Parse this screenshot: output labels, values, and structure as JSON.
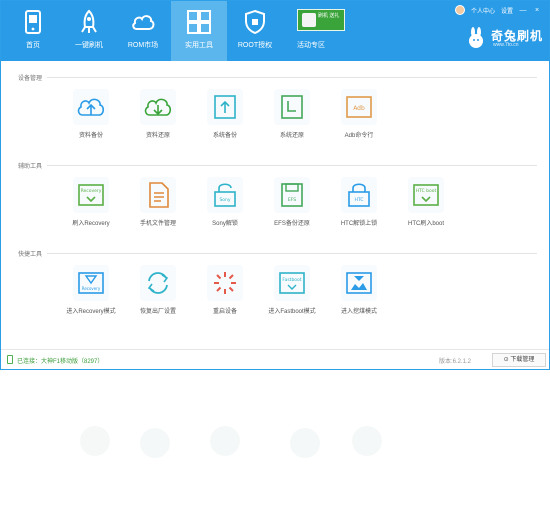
{
  "nav": [
    {
      "label": "首页",
      "icon": "home-icon"
    },
    {
      "label": "一键刷机",
      "icon": "rocket-icon"
    },
    {
      "label": "ROM市场",
      "icon": "cloud-icon"
    },
    {
      "label": "实用工具",
      "icon": "grid-icon"
    },
    {
      "label": "ROOT授权",
      "icon": "shield-icon"
    },
    {
      "label": "活动专区",
      "icon": "gift-icon"
    }
  ],
  "banner_text": "刷机\n送礼",
  "user": {
    "name": "个人中心",
    "settings": "设置",
    "minimize": "—",
    "close": "×"
  },
  "logo": {
    "name": "奇兔刷机",
    "url": "www.7to.cn"
  },
  "sections": [
    {
      "title": "设备管理",
      "tools": [
        {
          "label": "资料备份",
          "icon": "cloud-upload-icon"
        },
        {
          "label": "资料还原",
          "icon": "cloud-restore-icon"
        },
        {
          "label": "系统备份",
          "icon": "system-backup-icon"
        },
        {
          "label": "系统还原",
          "icon": "system-restore-icon"
        },
        {
          "label": "Adb命令行",
          "icon": "adb-terminal-icon"
        }
      ]
    },
    {
      "title": "辅助工具",
      "tools": [
        {
          "label": "刷入Recovery",
          "icon": "recovery-flash-icon"
        },
        {
          "label": "手机文件管理",
          "icon": "file-manager-icon"
        },
        {
          "label": "Sony解锁",
          "icon": "sony-unlock-icon"
        },
        {
          "label": "EFS备份还原",
          "icon": "efs-backup-icon"
        },
        {
          "label": "HTC解锁上锁",
          "icon": "htc-unlock-icon"
        },
        {
          "label": "HTC刷入boot",
          "icon": "htc-boot-icon"
        }
      ]
    },
    {
      "title": "快捷工具",
      "tools": [
        {
          "label": "进入Recovery模式",
          "icon": "enter-recovery-icon"
        },
        {
          "label": "恢复出厂设置",
          "icon": "factory-reset-icon"
        },
        {
          "label": "重启设备",
          "icon": "reboot-icon"
        },
        {
          "label": "进入Fastboot模式",
          "icon": "fastboot-icon"
        },
        {
          "label": "进入挖煤模式",
          "icon": "download-mode-icon"
        }
      ]
    }
  ],
  "status": {
    "device": "已连接：大神F1移动版（8297）",
    "version": "版本:6.2.1.2",
    "download_button": "下载管理"
  },
  "colors": {
    "primary": "#2a9be6",
    "active_tab": "#5cb6ee",
    "status_ok": "#3a9c3a"
  }
}
